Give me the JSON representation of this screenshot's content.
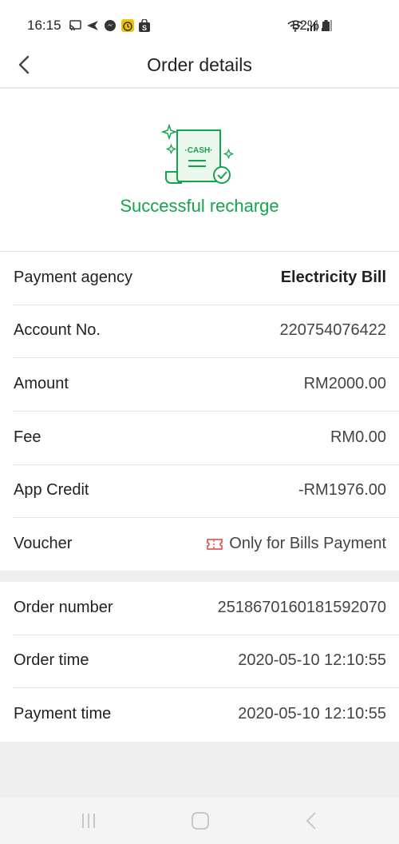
{
  "status_bar": {
    "time": "16:15",
    "battery_percent": "82%",
    "icons_left": [
      "cast-icon",
      "send-icon",
      "messenger-icon",
      "alarm-app-icon",
      "shopee-icon"
    ],
    "icons_right": [
      "wifi-icon",
      "signal-icon",
      "signal-icon",
      "battery-icon"
    ]
  },
  "header": {
    "title": "Order details",
    "back_icon": "chevron-left-icon"
  },
  "hero": {
    "icon": "cash-receipt-check-icon",
    "icon_text": "·CASH·",
    "status_text": "Successful recharge",
    "accent_color": "#14a54c"
  },
  "details": [
    {
      "label": "Payment agency",
      "value": "Electricity Bill"
    },
    {
      "label": "Account No.",
      "value": "220754076422"
    },
    {
      "label": "Amount",
      "value": "RM2000.00"
    },
    {
      "label": "Fee",
      "value": "RM0.00"
    },
    {
      "label": "App Credit",
      "value": "-RM1976.00"
    },
    {
      "label": "Voucher",
      "value": "Only for Bills Payment",
      "icon": "ticket-icon"
    }
  ],
  "order_info": [
    {
      "label": "Order number",
      "value": "2518670160181592070"
    },
    {
      "label": "Order time",
      "value": "2020-05-10 12:10:55"
    },
    {
      "label": "Payment time",
      "value": "2020-05-10 12:10:55"
    }
  ],
  "nav": {
    "icons": [
      "recents-icon",
      "home-icon",
      "back-icon"
    ]
  }
}
